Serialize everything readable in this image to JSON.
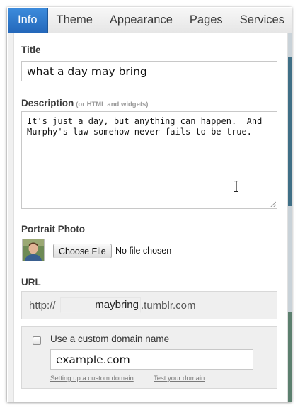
{
  "tabs": [
    {
      "label": "Info",
      "active": true
    },
    {
      "label": "Theme",
      "active": false
    },
    {
      "label": "Appearance",
      "active": false
    },
    {
      "label": "Pages",
      "active": false
    },
    {
      "label": "Services",
      "active": false
    }
  ],
  "info": {
    "title_label": "Title",
    "title_value": "what a day may bring",
    "description_label": "Description",
    "description_hint": "(or HTML and widgets)",
    "description_value": "It's just a day, but anything can happen.  And Murphy's law somehow never fails to be true.",
    "portrait_label": "Portrait Photo",
    "choose_file_label": "Choose File",
    "file_status": "No file chosen",
    "url_label": "URL",
    "url_prefix": "http://",
    "url_value": "maybring",
    "url_suffix": ".tumblr.com",
    "custom_domain_label": "Use a custom domain name",
    "custom_domain_checked": false,
    "custom_domain_placeholder": "example.com",
    "setup_link": "Setting up a custom domain",
    "test_link": "Test your domain"
  },
  "colors": {
    "active_tab": "#2a72c6",
    "tab_bar": "#ececec",
    "panel_bg": "#ffffff",
    "field_box_bg": "#efefef"
  }
}
